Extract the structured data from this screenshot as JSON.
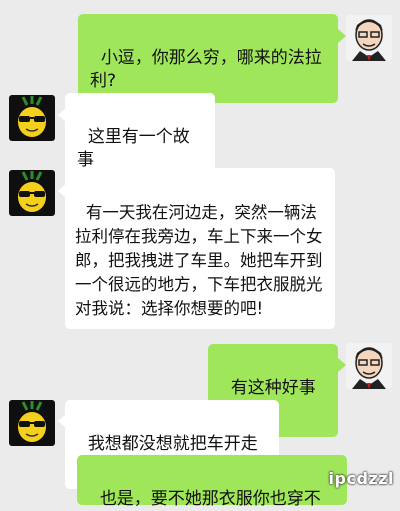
{
  "messages": [
    {
      "sender": "me",
      "text": "小逗，你那么穷，哪来的法拉利?"
    },
    {
      "sender": "other",
      "text": "这里有一个故事"
    },
    {
      "sender": "other",
      "text": "有一天我在河边走，突然一辆法拉利停在我旁边，车上下来一个女郎，把我拽进了车里。她把车开到一个很远的地方，下车把衣服脱光对我说：选择你想要的吧!"
    },
    {
      "sender": "me",
      "text": "有这种好事"
    },
    {
      "sender": "other",
      "text": "我想都没想就把车开走了"
    },
    {
      "sender": "me",
      "text": "也是，要不她那衣服你也穿不"
    }
  ],
  "icons": {
    "my_avatar": "cartoon-man-avatar",
    "other_avatar": "sunglasses-pineapple-avatar",
    "heart_eyes": "heart-eyes-emoji"
  },
  "colors": {
    "background": "#ebebeb",
    "my_bubble": "#9fe65a",
    "other_bubble": "#ffffff"
  },
  "watermark": "ipcdzzl"
}
